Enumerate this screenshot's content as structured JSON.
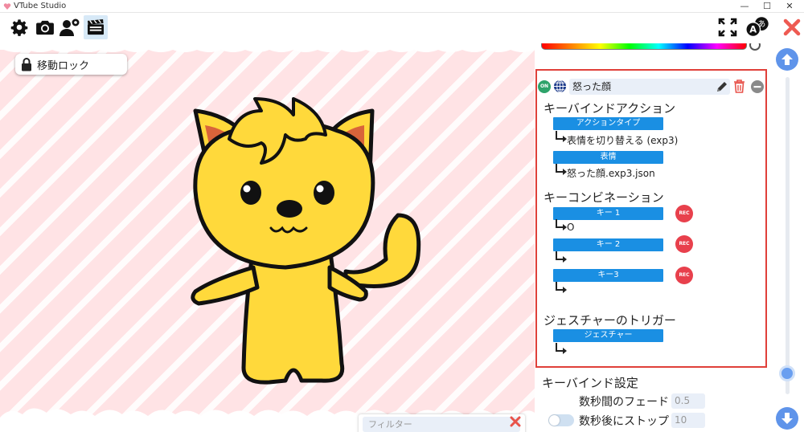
{
  "window": {
    "title": "VTube Studio",
    "minimize_glyph": "—",
    "maximize_glyph": "☐",
    "close_glyph": "✕"
  },
  "toolbar": {
    "left_icons": [
      "gear-icon",
      "camera-icon",
      "user-settings-icon",
      "clapperboard-icon"
    ],
    "right_icons": [
      "fullscreen-icon",
      "language-icon",
      "close-x-icon"
    ],
    "active": "clapperboard-icon",
    "language_glyph_a": "A",
    "language_glyph_b": "あ"
  },
  "stage": {
    "lock_button_label": "移動ロック",
    "filter_placeholder": "フィルター",
    "background_color": "#ffe3e5"
  },
  "hotkey": {
    "on_badge": "ON",
    "name": "怒った顔",
    "action_section_title": "キーバインドアクション",
    "action_type_label": "アクションタイプ",
    "action_type_value": "表情を切り替える (exp3)",
    "expression_label": "表情",
    "expression_value": "怒った顔.exp3.json",
    "combination_title": "キーコンビネーション",
    "keys": [
      {
        "label": "キー 1",
        "value": "O",
        "rec": "REC"
      },
      {
        "label": "キー 2",
        "value": "",
        "rec": "REC"
      },
      {
        "label": "キー3",
        "value": "",
        "rec": "REC"
      }
    ],
    "gesture_title": "ジェスチャーのトリガー",
    "gesture_label": "ジェスチャー",
    "gesture_value": ""
  },
  "settings": {
    "title": "キーバインド設定",
    "fade_label": "数秒間のフェード",
    "fade_value": "0.5",
    "stop_label": "数秒後にストップ",
    "stop_value": "10"
  },
  "colors": {
    "accent_blue": "#1a8fe3",
    "highlight_red": "#e0403a",
    "rec_red": "#e8404c",
    "on_green": "#2ea36a",
    "scroll_blue": "#5f94ea"
  }
}
